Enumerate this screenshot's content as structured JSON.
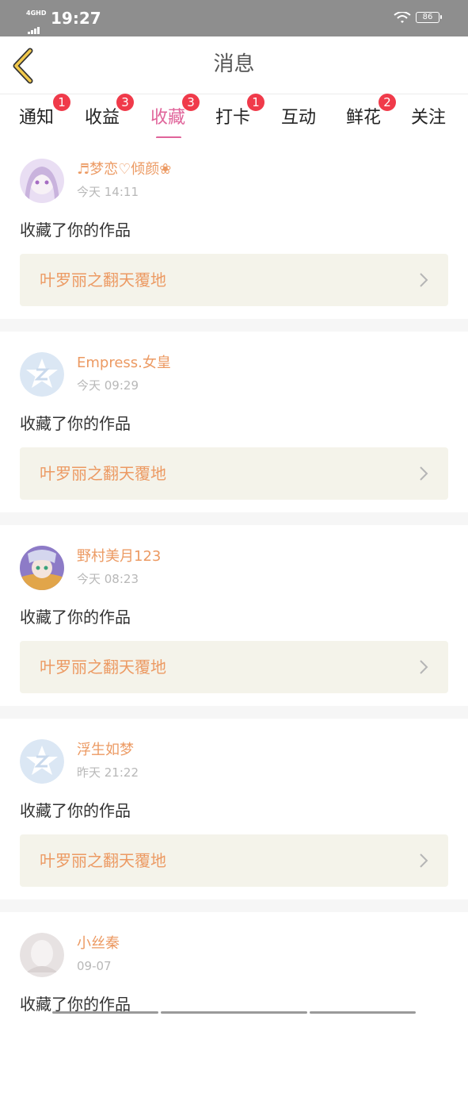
{
  "status_bar": {
    "network": "4GHD",
    "time": "19:27",
    "battery": "86"
  },
  "header": {
    "title": "消息"
  },
  "tabs": [
    {
      "label": "通知",
      "badge": "1"
    },
    {
      "label": "收益",
      "badge": "3"
    },
    {
      "label": "收藏",
      "badge": "3",
      "active": true
    },
    {
      "label": "打卡",
      "badge": "1"
    },
    {
      "label": "互动",
      "badge": ""
    },
    {
      "label": "鲜花",
      "badge": "2"
    },
    {
      "label": "关注",
      "badge": ""
    }
  ],
  "feed": [
    {
      "username": "♬梦恋♡倾颜❀",
      "time": "今天 14:11",
      "action": "收藏了你的作品",
      "work": "叶罗丽之翻天覆地",
      "avatar": "anime-girl-avatar"
    },
    {
      "username": "Empress.女皇",
      "time": "今天 09:29",
      "action": "收藏了你的作品",
      "work": "叶罗丽之翻天覆地",
      "avatar": "default-star-avatar"
    },
    {
      "username": "野村美月123",
      "time": "今天 08:23",
      "action": "收藏了你的作品",
      "work": "叶罗丽之翻天覆地",
      "avatar": "anime-character-avatar"
    },
    {
      "username": "浮生如梦",
      "time": "昨天 21:22",
      "action": "收藏了你的作品",
      "work": "叶罗丽之翻天覆地",
      "avatar": "default-star-avatar"
    },
    {
      "username": "小丝秦",
      "time": "09-07",
      "action": "收藏了你的作品",
      "work": "",
      "avatar": "grey-portrait-avatar"
    }
  ],
  "colors": {
    "accent": "#e0649a",
    "username": "#ec9a63",
    "badge": "#f03a4a",
    "work_bg": "#f4f3ea"
  }
}
